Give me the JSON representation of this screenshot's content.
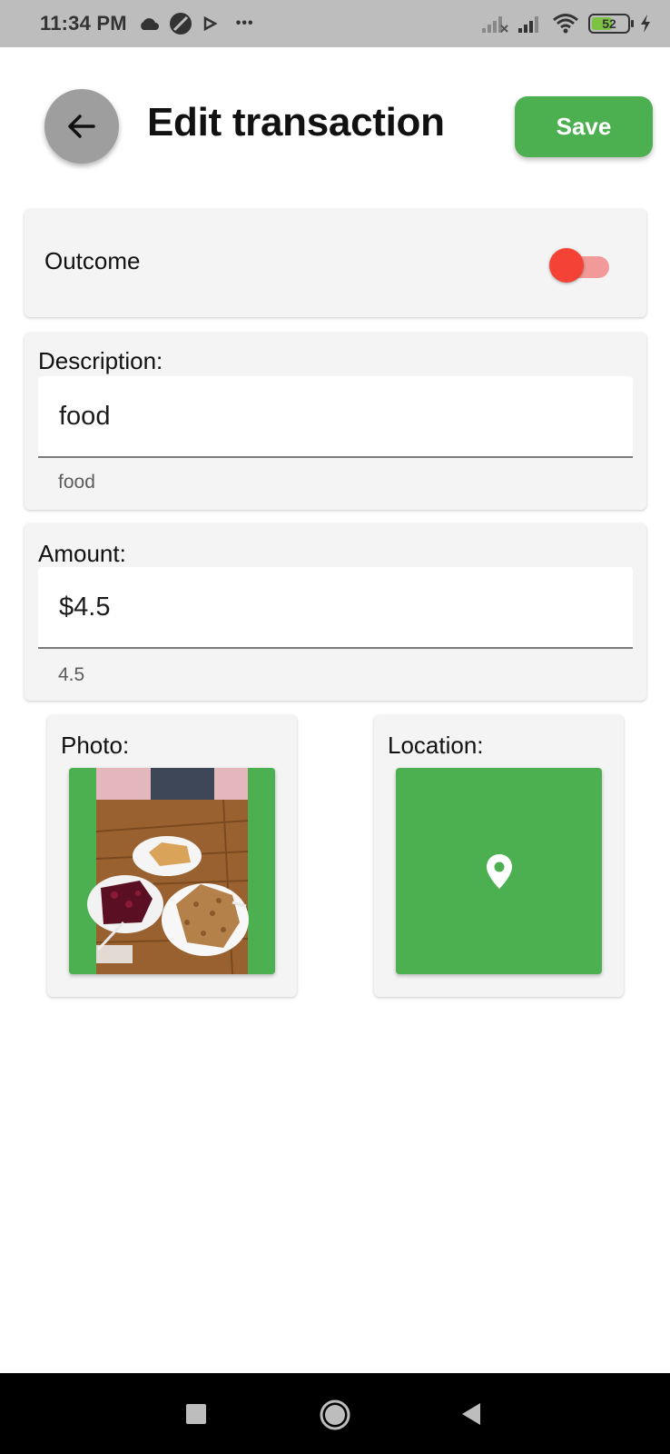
{
  "status_bar": {
    "time": "11:34 PM",
    "more": "•••",
    "battery": "52",
    "left_icons": [
      "cloud-icon",
      "circle-slash-icon",
      "play-icon"
    ],
    "right_icons": [
      "signal-no-icon",
      "signal-icon",
      "wifi-icon",
      "battery-icon",
      "charging-icon"
    ]
  },
  "header": {
    "title": "Edit transaction",
    "save_label": "Save",
    "back_icon": "arrow-left-icon"
  },
  "outcome": {
    "label": "Outcome",
    "toggle_color": "#f44336",
    "toggle_on": true
  },
  "description": {
    "label": "Description:",
    "value": "food",
    "helper": "food"
  },
  "amount": {
    "label": "Amount:",
    "value": "$4.5",
    "helper": "4.5"
  },
  "photo": {
    "label": "Photo:"
  },
  "location": {
    "label": "Location:",
    "icon": "map-pin-icon"
  },
  "nav": {
    "icons": [
      "recents-square-icon",
      "home-circle-icon",
      "back-triangle-icon"
    ]
  },
  "colors": {
    "accent": "#4caf50",
    "card": "#f4f4f4",
    "toggle": "#f44336"
  }
}
